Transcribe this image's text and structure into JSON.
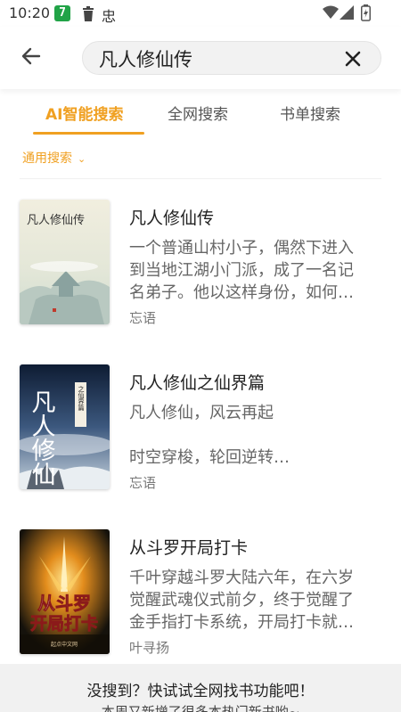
{
  "status_bar": {
    "time": "10:20",
    "app_badge": "7",
    "sim_glyph": "忠"
  },
  "search": {
    "query": "凡人修仙传"
  },
  "tabs": [
    {
      "label": "AI智能搜索",
      "active": true
    },
    {
      "label": "全网搜索",
      "active": false
    },
    {
      "label": "书单搜索",
      "active": false
    }
  ],
  "filter": {
    "label": "通用搜索",
    "chevron": "⌄"
  },
  "books": [
    {
      "title": "凡人修仙传",
      "desc_lines": [
        "一个普通山村小子，偶然下进入",
        "到当地江湖小门派，成了一名记",
        "名弟子。他以这样身份，如何…"
      ],
      "author": "忘语",
      "cover_text": "凡人修仙传"
    },
    {
      "title": "凡人修仙之仙界篇",
      "desc_lines": [
        "凡人修仙，风云再起",
        "",
        "时空穿梭，轮回逆转…"
      ],
      "author": "忘语",
      "cover_text": "凡人修仙",
      "cover_sub": "之仙界篇"
    },
    {
      "title": "从斗罗开局打卡",
      "desc_lines": [
        "千叶穿越斗罗大陆六年，在六岁",
        "觉醒武魂仪式前夕，终于觉醒了",
        "金手指打卡系统，开局打卡就…"
      ],
      "author": "叶寻扬",
      "cover_line1": "从斗罗",
      "cover_line2": "开局打卡",
      "cover_publisher": "起点中文网"
    }
  ],
  "footer": {
    "main": "没搜到？快试试全网找书功能吧！",
    "sub": "本周又新增了很多本热门新书哟~"
  },
  "colors": {
    "accent": "#f0a021",
    "status_badge": "#21a347"
  }
}
